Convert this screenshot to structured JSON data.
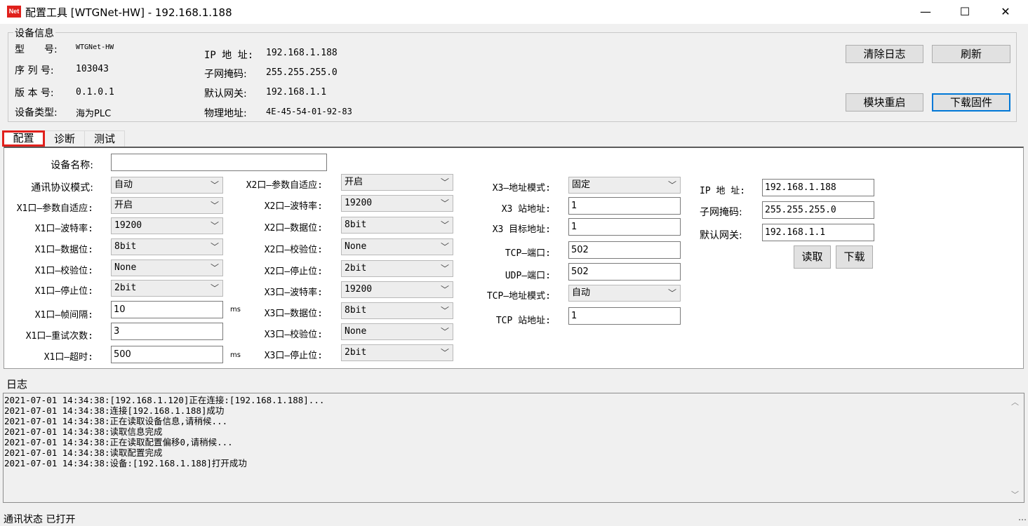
{
  "window": {
    "title": "配置工具 [WTGNet-HW] - 192.168.1.188",
    "icon_text": "Net",
    "minimize": "—",
    "maximize": "☐",
    "close": "✕"
  },
  "device_info": {
    "group_title": "设备信息",
    "model_label": "型　　号:",
    "model": "WTGNet-HW",
    "serial_label": "序 列 号:",
    "serial": "103043",
    "version_label": "版 本 号:",
    "version": "0.1.0.1",
    "type_label": "设备类型:",
    "type": "海为PLC",
    "ip_label": "IP 地 址:",
    "ip": "192.168.1.188",
    "mask_label": "子网掩码:",
    "mask": "255.255.255.0",
    "gateway_label": "默认网关:",
    "gateway": "192.168.1.1",
    "mac_label": "物理地址:",
    "mac": "4E-45-54-01-92-83",
    "buttons": {
      "clear_log": "清除日志",
      "refresh": "刷新",
      "restart": "模块重启",
      "firmware": "下载固件"
    }
  },
  "tabs": [
    "配置",
    "诊断",
    "测试"
  ],
  "config": {
    "device_name_label": "设备名称:",
    "device_name": "",
    "protocol_label": "通讯协议模式:",
    "protocol": "自动",
    "x1_adapt_label": "X1口—参数自适应:",
    "x1_adapt": "开启",
    "x1_baud_label": "X1口—波特率:",
    "x1_baud": "19200",
    "x1_data_label": "X1口—数据位:",
    "x1_data": "8bit",
    "x1_parity_label": "X1口—校验位:",
    "x1_parity": "None",
    "x1_stop_label": "X1口—停止位:",
    "x1_stop": "2bit",
    "x1_frame_label": "X1口—帧间隔:",
    "x1_frame": "10",
    "x1_retry_label": "X1口—重试次数:",
    "x1_retry": "3",
    "x1_timeout_label": "X1口—超时:",
    "x1_timeout": "500",
    "unit_ms": "ms",
    "x2_adapt_label": "X2口—参数自适应:",
    "x2_adapt": "开启",
    "x2_baud_label": "X2口—波特率:",
    "x2_baud": "19200",
    "x2_data_label": "X2口—数据位:",
    "x2_data": "8bit",
    "x2_parity_label": "X2口—校验位:",
    "x2_parity": "None",
    "x2_stop_label": "X2口—停止位:",
    "x2_stop": "2bit",
    "x3_baud_label": "X3口—波特率:",
    "x3_baud": "19200",
    "x3_data_label": "X3口—数据位:",
    "x3_data": "8bit",
    "x3_parity_label": "X3口—校验位:",
    "x3_parity": "None",
    "x3_stop_label": "X3口—停止位:",
    "x3_stop": "2bit",
    "x3_addr_mode_label": "X3—地址模式:",
    "x3_addr_mode": "固定",
    "x3_station_label": "X3 站地址:",
    "x3_station": "1",
    "x3_target_label": "X3 目标地址:",
    "x3_target": "1",
    "tcp_port_label": "TCP—端口:",
    "tcp_port": "502",
    "udp_port_label": "UDP—端口:",
    "udp_port": "502",
    "tcp_addr_mode_label": "TCP—地址模式:",
    "tcp_addr_mode": "自动",
    "tcp_station_label": "TCP 站地址:",
    "tcp_station": "1",
    "net_ip_label": "IP 地 址:",
    "net_ip": "192.168.1.188",
    "net_mask_label": "子网掩码:",
    "net_mask": "255.255.255.0",
    "net_gateway_label": "默认网关:",
    "net_gateway": "192.168.1.1",
    "read_button": "读取",
    "download_button": "下载"
  },
  "log": {
    "label": "日志",
    "lines": [
      "2021-07-01 14:34:38:[192.168.1.120]正在连接:[192.168.1.188]...",
      "2021-07-01 14:34:38:连接[192.168.1.188]成功",
      "2021-07-01 14:34:38:正在读取设备信息,请稍候...",
      "2021-07-01 14:34:38:读取信息完成",
      "2021-07-01 14:34:38:正在读取配置偏移0,请稍候...",
      "2021-07-01 14:34:38:读取配置完成",
      "2021-07-01 14:34:38:设备:[192.168.1.188]打开成功"
    ]
  },
  "status": {
    "text": "通讯状态  已打开"
  }
}
